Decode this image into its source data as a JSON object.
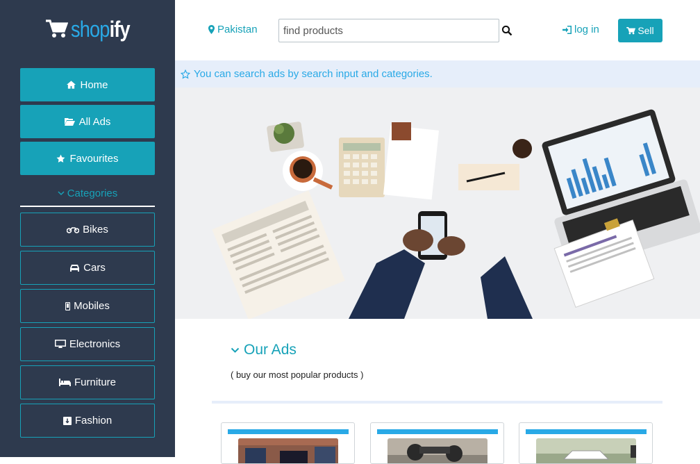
{
  "brand": {
    "light": "shop",
    "bold": "ify"
  },
  "sidebar": {
    "nav": [
      {
        "label": "Home",
        "icon": "home-icon"
      },
      {
        "label": "All Ads",
        "icon": "folder-open-icon"
      },
      {
        "label": "Favourites",
        "icon": "star-icon"
      }
    ],
    "categories_label": "Categories",
    "categories": [
      {
        "label": "Bikes",
        "icon": "motorcycle-icon"
      },
      {
        "label": "Cars",
        "icon": "car-icon"
      },
      {
        "label": "Mobiles",
        "icon": "mobile-icon"
      },
      {
        "label": "Electronics",
        "icon": "desktop-icon"
      },
      {
        "label": "Furniture",
        "icon": "bed-icon"
      },
      {
        "label": "Fashion",
        "icon": "shirt-icon"
      }
    ]
  },
  "topbar": {
    "location": "Pakistan",
    "search_placeholder": "find products",
    "login": "log in",
    "sell": "Sell"
  },
  "info": {
    "text": "You can search ads by search input and categories."
  },
  "ads": {
    "title": "Our Ads",
    "subtitle": "( buy our most popular products )",
    "cards": [
      {
        "name": "bikes-ad"
      },
      {
        "name": "motorbike-ad"
      },
      {
        "name": "car-ad"
      }
    ]
  },
  "colors": {
    "sidebar": "#2e3a4e",
    "accent": "#17a2b8",
    "link": "#29a9e6",
    "info_bg": "#e6eefa"
  }
}
